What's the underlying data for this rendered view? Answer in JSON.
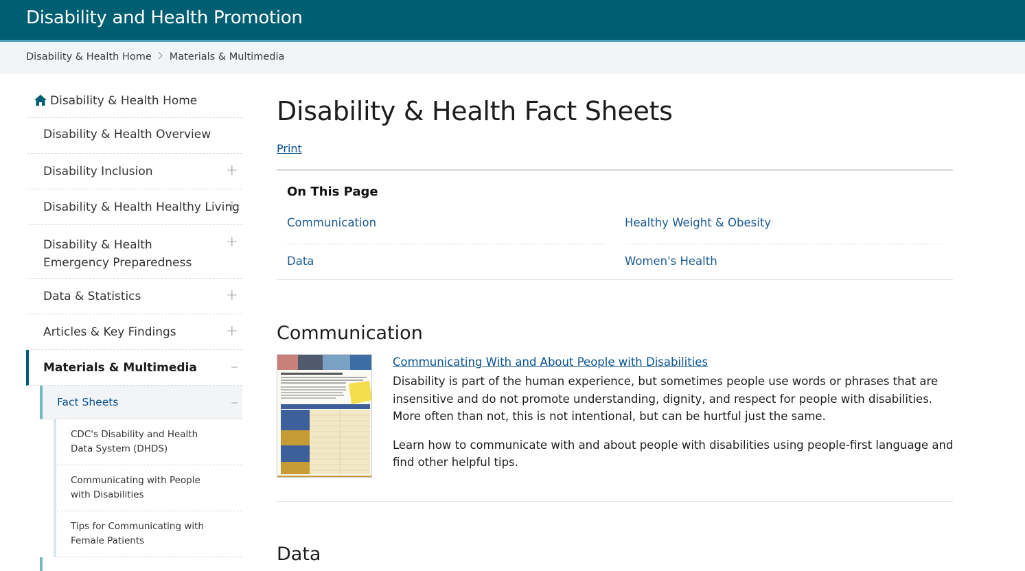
{
  "header": {
    "site_title": "Disability and Health Promotion"
  },
  "breadcrumb": [
    "Disability & Health Home",
    "Materials & Multimedia"
  ],
  "sidebar": {
    "home_label": "Disability & Health Home",
    "items": [
      {
        "label": "Disability & Health Overview",
        "expand": ""
      },
      {
        "label": "Disability Inclusion",
        "expand": "+"
      },
      {
        "label": "Disability & Health Healthy Living",
        "expand": "+"
      },
      {
        "label": "Disability & Health Emergency Preparedness",
        "expand": "+"
      },
      {
        "label": "Data & Statistics",
        "expand": "+"
      },
      {
        "label": "Articles & Key Findings",
        "expand": "+"
      },
      {
        "label": "Materials & Multimedia",
        "expand": "–"
      }
    ],
    "fact_sheets": {
      "label": "Fact Sheets",
      "expand": "–"
    },
    "sub_items": [
      "CDC's Disability and Health Data System (DHDS)",
      "Communicating with People with Disabilities",
      "Tips for Communicating with Female Patients"
    ]
  },
  "main": {
    "title": "Disability & Health Fact Sheets",
    "print": "Print",
    "on_this_page": {
      "title": "On This Page",
      "links": [
        "Communication",
        "Healthy Weight & Obesity",
        "Data",
        "Women's Health"
      ]
    },
    "sections": [
      {
        "heading": "Communication",
        "link": "Communicating With and About People with Disabilities",
        "paragraphs": [
          "Disability is part of the human experience, but sometimes people use words or phrases that are insensitive and do not promote understanding, dignity, and respect for people with disabilities. More often than not, this is not intentional, but can be hurtful just the same.",
          "Learn how to communicate with and about people with disabilities using people-first language and find other helpful tips."
        ]
      },
      {
        "heading": "Data"
      }
    ]
  },
  "colors": {
    "header_bg": "#005e73",
    "header_accent": "#4fa1b7",
    "link": "#075290",
    "active_bar": "#005e73",
    "sub_bar": "#72b7c2"
  },
  "icons": {
    "home": "home-icon",
    "expand": "plus-icon",
    "collapse": "minus-icon",
    "breadcrumb_sep": "chevron-right-icon"
  }
}
